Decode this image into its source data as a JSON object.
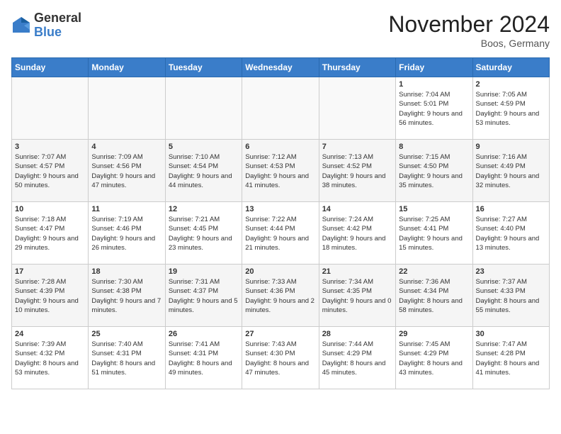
{
  "logo": {
    "general": "General",
    "blue": "Blue"
  },
  "title": "November 2024",
  "location": "Boos, Germany",
  "days_header": [
    "Sunday",
    "Monday",
    "Tuesday",
    "Wednesday",
    "Thursday",
    "Friday",
    "Saturday"
  ],
  "weeks": [
    [
      {
        "day": "",
        "info": ""
      },
      {
        "day": "",
        "info": ""
      },
      {
        "day": "",
        "info": ""
      },
      {
        "day": "",
        "info": ""
      },
      {
        "day": "",
        "info": ""
      },
      {
        "day": "1",
        "info": "Sunrise: 7:04 AM\nSunset: 5:01 PM\nDaylight: 9 hours and 56 minutes."
      },
      {
        "day": "2",
        "info": "Sunrise: 7:05 AM\nSunset: 4:59 PM\nDaylight: 9 hours and 53 minutes."
      }
    ],
    [
      {
        "day": "3",
        "info": "Sunrise: 7:07 AM\nSunset: 4:57 PM\nDaylight: 9 hours and 50 minutes."
      },
      {
        "day": "4",
        "info": "Sunrise: 7:09 AM\nSunset: 4:56 PM\nDaylight: 9 hours and 47 minutes."
      },
      {
        "day": "5",
        "info": "Sunrise: 7:10 AM\nSunset: 4:54 PM\nDaylight: 9 hours and 44 minutes."
      },
      {
        "day": "6",
        "info": "Sunrise: 7:12 AM\nSunset: 4:53 PM\nDaylight: 9 hours and 41 minutes."
      },
      {
        "day": "7",
        "info": "Sunrise: 7:13 AM\nSunset: 4:52 PM\nDaylight: 9 hours and 38 minutes."
      },
      {
        "day": "8",
        "info": "Sunrise: 7:15 AM\nSunset: 4:50 PM\nDaylight: 9 hours and 35 minutes."
      },
      {
        "day": "9",
        "info": "Sunrise: 7:16 AM\nSunset: 4:49 PM\nDaylight: 9 hours and 32 minutes."
      }
    ],
    [
      {
        "day": "10",
        "info": "Sunrise: 7:18 AM\nSunset: 4:47 PM\nDaylight: 9 hours and 29 minutes."
      },
      {
        "day": "11",
        "info": "Sunrise: 7:19 AM\nSunset: 4:46 PM\nDaylight: 9 hours and 26 minutes."
      },
      {
        "day": "12",
        "info": "Sunrise: 7:21 AM\nSunset: 4:45 PM\nDaylight: 9 hours and 23 minutes."
      },
      {
        "day": "13",
        "info": "Sunrise: 7:22 AM\nSunset: 4:44 PM\nDaylight: 9 hours and 21 minutes."
      },
      {
        "day": "14",
        "info": "Sunrise: 7:24 AM\nSunset: 4:42 PM\nDaylight: 9 hours and 18 minutes."
      },
      {
        "day": "15",
        "info": "Sunrise: 7:25 AM\nSunset: 4:41 PM\nDaylight: 9 hours and 15 minutes."
      },
      {
        "day": "16",
        "info": "Sunrise: 7:27 AM\nSunset: 4:40 PM\nDaylight: 9 hours and 13 minutes."
      }
    ],
    [
      {
        "day": "17",
        "info": "Sunrise: 7:28 AM\nSunset: 4:39 PM\nDaylight: 9 hours and 10 minutes."
      },
      {
        "day": "18",
        "info": "Sunrise: 7:30 AM\nSunset: 4:38 PM\nDaylight: 9 hours and 7 minutes."
      },
      {
        "day": "19",
        "info": "Sunrise: 7:31 AM\nSunset: 4:37 PM\nDaylight: 9 hours and 5 minutes."
      },
      {
        "day": "20",
        "info": "Sunrise: 7:33 AM\nSunset: 4:36 PM\nDaylight: 9 hours and 2 minutes."
      },
      {
        "day": "21",
        "info": "Sunrise: 7:34 AM\nSunset: 4:35 PM\nDaylight: 9 hours and 0 minutes."
      },
      {
        "day": "22",
        "info": "Sunrise: 7:36 AM\nSunset: 4:34 PM\nDaylight: 8 hours and 58 minutes."
      },
      {
        "day": "23",
        "info": "Sunrise: 7:37 AM\nSunset: 4:33 PM\nDaylight: 8 hours and 55 minutes."
      }
    ],
    [
      {
        "day": "24",
        "info": "Sunrise: 7:39 AM\nSunset: 4:32 PM\nDaylight: 8 hours and 53 minutes."
      },
      {
        "day": "25",
        "info": "Sunrise: 7:40 AM\nSunset: 4:31 PM\nDaylight: 8 hours and 51 minutes."
      },
      {
        "day": "26",
        "info": "Sunrise: 7:41 AM\nSunset: 4:31 PM\nDaylight: 8 hours and 49 minutes."
      },
      {
        "day": "27",
        "info": "Sunrise: 7:43 AM\nSunset: 4:30 PM\nDaylight: 8 hours and 47 minutes."
      },
      {
        "day": "28",
        "info": "Sunrise: 7:44 AM\nSunset: 4:29 PM\nDaylight: 8 hours and 45 minutes."
      },
      {
        "day": "29",
        "info": "Sunrise: 7:45 AM\nSunset: 4:29 PM\nDaylight: 8 hours and 43 minutes."
      },
      {
        "day": "30",
        "info": "Sunrise: 7:47 AM\nSunset: 4:28 PM\nDaylight: 8 hours and 41 minutes."
      }
    ]
  ]
}
